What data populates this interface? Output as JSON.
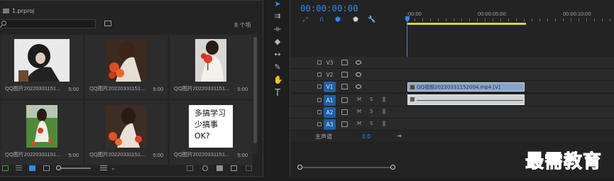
{
  "project": {
    "file_name": "1.prproj",
    "item_count": "8 个项",
    "items": [
      {
        "caption": "QQ图片20220331151...",
        "duration": "5:00"
      },
      {
        "caption": "QQ图片20220331151...",
        "duration": "5:00"
      },
      {
        "caption": "QQ图片20220331151...",
        "duration": "5:00"
      },
      {
        "caption": "QQ图片20220331151...",
        "duration": "5:00"
      },
      {
        "caption": "QQ图片20220331151...",
        "duration": "5:00"
      },
      {
        "caption": "QQ图片20220331151...",
        "duration": "5:00",
        "thumb_text": [
          "多搞学习",
          "少搞事",
          "OK?"
        ]
      }
    ]
  },
  "timeline": {
    "timecode": "00:00:00:00",
    "ruler": [
      ":00:00",
      "00:00:05:00",
      "00:00:10:00"
    ],
    "video_tracks": [
      "V3",
      "V2",
      "V1"
    ],
    "audio_tracks": [
      "A1",
      "A2",
      "A3"
    ],
    "master_label": "主声道",
    "master_value": "0.0",
    "mute_label": "M",
    "solo_label": "S",
    "video_clip_name": "QQ视频20220331152004.mp4 [V]"
  },
  "watermark": "最需教育",
  "colors": {
    "accent": "#2d8ceb",
    "work_area": "#d7d33a",
    "video_clip": "#8aa3c9",
    "audio_clip": "#cfd3d8"
  }
}
